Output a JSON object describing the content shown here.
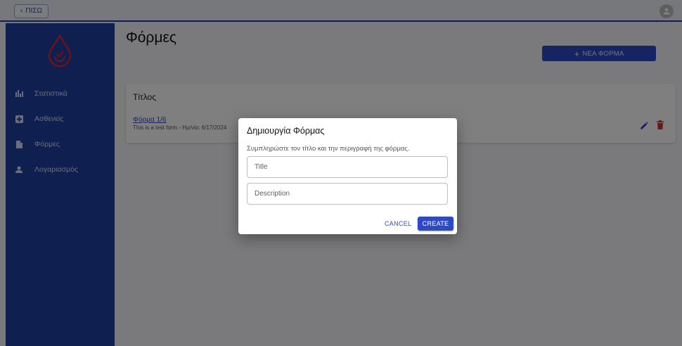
{
  "topbar": {
    "back_label": "ΠΙΣΩ"
  },
  "sidebar": {
    "items": [
      {
        "label": "Στατιστικά",
        "icon": "bar-chart-icon"
      },
      {
        "label": "Ασθενείς",
        "icon": "medical-plus-icon"
      },
      {
        "label": "Φόρμες",
        "icon": "document-icon"
      },
      {
        "label": "Λογαριασμός",
        "icon": "person-icon"
      }
    ]
  },
  "main": {
    "page_title": "Φόρμες",
    "new_form_label": "ΝΕΑ ΦΟΡΜΑ",
    "card": {
      "header": "Τίτλος",
      "form_title": "Φόρμα 1/6",
      "form_description": "This is a test form - Ημ/νία: 6/17/2024"
    }
  },
  "dialog": {
    "title": "Δημιουργία Φόρμας",
    "text": "Συμπληρώστε τον τίτλο και την περιγραφή της φόρμας.",
    "title_placeholder": "Title",
    "description_placeholder": "Description",
    "cancel_label": "CANCEL",
    "create_label": "CREATE"
  },
  "colors": {
    "primary": "#2b4bc6",
    "sidebar": "#1e3f9e",
    "danger": "#d32f2f",
    "logo": "#d8262d"
  }
}
